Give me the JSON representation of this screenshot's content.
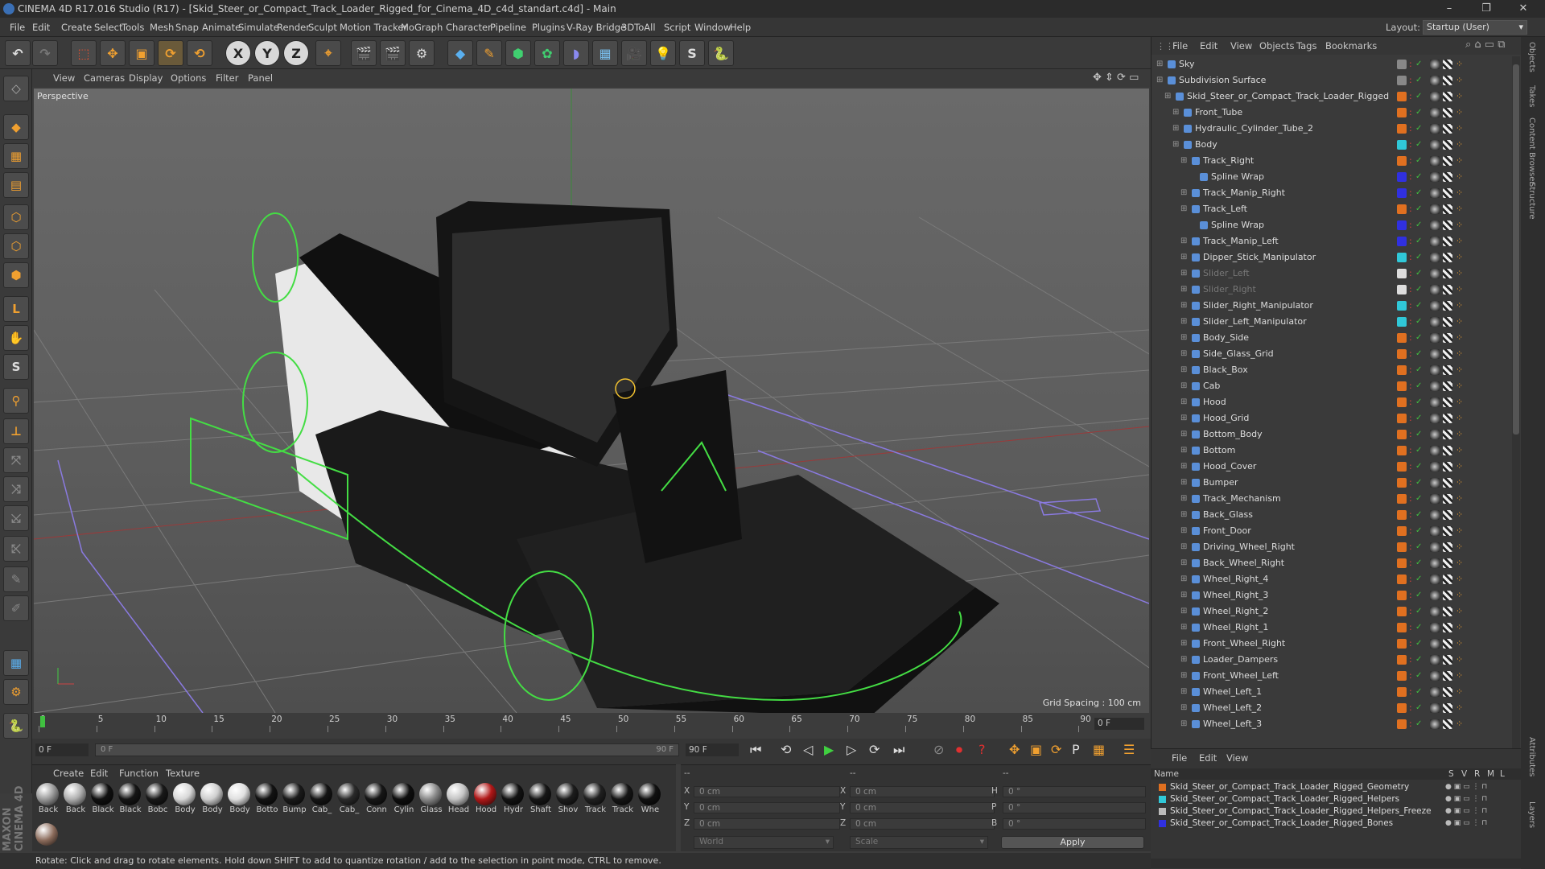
{
  "window": {
    "title": "CINEMA 4D R17.016 Studio (R17) - [Skid_Steer_or_Compact_Track_Loader_Rigged_for_Cinema_4D_c4d_standart.c4d] - Main",
    "minimize": "–",
    "restore": "❐",
    "close": "✕"
  },
  "menubar": {
    "items": [
      "File",
      "Edit",
      "Create",
      "Select",
      "Tools",
      "Mesh",
      "Snap",
      "Animate",
      "Simulate",
      "Render",
      "Sculpt",
      "Motion Tracker",
      "MoGraph",
      "Character",
      "Pipeline",
      "Plugins",
      "V-Ray Bridge",
      "3DToAll",
      "Script",
      "Window",
      "Help"
    ],
    "layout_label": "Layout:",
    "layout_value": "Startup (User)"
  },
  "toolbar": {
    "axis_x": "X",
    "axis_y": "Y",
    "axis_z": "Z"
  },
  "viewport": {
    "menu": [
      "View",
      "Cameras",
      "Display",
      "Options",
      "Filter",
      "Panel"
    ],
    "label": "Perspective",
    "grid_spacing": "Grid Spacing : 100 cm"
  },
  "timeline": {
    "ticks": [
      "0",
      "5",
      "10",
      "15",
      "20",
      "25",
      "30",
      "35",
      "40",
      "45",
      "50",
      "55",
      "60",
      "65",
      "70",
      "75",
      "80",
      "85",
      "90"
    ],
    "current_frame": "0 F",
    "start_field": "0 F",
    "range_start": "0 F",
    "range_end": "90 F",
    "end_field": "90 F"
  },
  "materials": {
    "menu": [
      "Create",
      "Edit",
      "Function",
      "Texture"
    ],
    "items": [
      {
        "name": "Back",
        "color": "#9a9a9a"
      },
      {
        "name": "Back",
        "color": "#b0b0b0"
      },
      {
        "name": "Black",
        "color": "#101010"
      },
      {
        "name": "Black",
        "color": "#151515"
      },
      {
        "name": "Bobc",
        "color": "#181818"
      },
      {
        "name": "Body",
        "color": "#d8d8d8"
      },
      {
        "name": "Body",
        "color": "#cfcfcf"
      },
      {
        "name": "Body",
        "color": "#e0e0e0"
      },
      {
        "name": "Botto",
        "color": "#121212"
      },
      {
        "name": "Bump",
        "color": "#1a1a1a"
      },
      {
        "name": "Cab_",
        "color": "#141414"
      },
      {
        "name": "Cab_",
        "color": "#2a2a2a"
      },
      {
        "name": "Conn",
        "color": "#161616"
      },
      {
        "name": "Cylin",
        "color": "#0e0e0e"
      },
      {
        "name": "Glass",
        "color": "#8a8a8a"
      },
      {
        "name": "Head",
        "color": "#c4c4c4"
      },
      {
        "name": "Hood",
        "color": "#b01818"
      },
      {
        "name": "Hydr",
        "color": "#121212"
      },
      {
        "name": "Shaft",
        "color": "#161616"
      },
      {
        "name": "Shov",
        "color": "#1c1c1c"
      },
      {
        "name": "Track",
        "color": "#202020"
      },
      {
        "name": "Track",
        "color": "#151515"
      },
      {
        "name": "Whe",
        "color": "#101010"
      }
    ],
    "extra_color": "#8a6a5a"
  },
  "attributes": {
    "x_label": "X",
    "y_label": "Y",
    "z_label": "Z",
    "pos_x": "0 cm",
    "pos_y": "0 cm",
    "pos_z": "0 cm",
    "size_x_label": "X",
    "size_y_label": "Y",
    "size_z_label": "Z",
    "size_x": "0 cm",
    "size_y": "0 cm",
    "size_z": "0 cm",
    "h_label": "H",
    "p_label": "P",
    "b_label": "B",
    "h": "0 °",
    "p": "0 °",
    "b": "0 °",
    "coord_mode": "World",
    "size_mode": "Scale",
    "apply": "Apply",
    "header_left": "--",
    "header_mid": "--",
    "header_right": "--"
  },
  "status": "Rotate: Click and drag to rotate elements. Hold down SHIFT to add to quantize rotation / add to the selection in point mode, CTRL to remove.",
  "object_manager": {
    "menu": [
      "File",
      "Edit",
      "View",
      "Objects",
      "Tags",
      "Bookmarks"
    ],
    "objects": [
      {
        "name": "Sky",
        "indent": 0,
        "color": "#888888"
      },
      {
        "name": "Subdivision Surface",
        "indent": 0,
        "color": "#888888"
      },
      {
        "name": "Skid_Steer_or_Compact_Track_Loader_Rigged",
        "indent": 1,
        "color": "#e07020"
      },
      {
        "name": "Front_Tube",
        "indent": 2,
        "color": "#e07020"
      },
      {
        "name": "Hydraulic_Cylinder_Tube_2",
        "indent": 2,
        "color": "#e07020"
      },
      {
        "name": "Body",
        "indent": 2,
        "color": "#30c8d8"
      },
      {
        "name": "Track_Right",
        "indent": 3,
        "color": "#e07020"
      },
      {
        "name": "Spline Wrap",
        "indent": 4,
        "color": "#3030e0"
      },
      {
        "name": "Track_Manip_Right",
        "indent": 3,
        "color": "#3030e0"
      },
      {
        "name": "Track_Left",
        "indent": 3,
        "color": "#e07020"
      },
      {
        "name": "Spline Wrap",
        "indent": 4,
        "color": "#3030e0"
      },
      {
        "name": "Track_Manip_Left",
        "indent": 3,
        "color": "#3030e0"
      },
      {
        "name": "Dipper_Stick_Manipulator",
        "indent": 3,
        "color": "#30c8d8"
      },
      {
        "name": "Slider_Left",
        "indent": 3,
        "color": "#dddddd",
        "dim": true
      },
      {
        "name": "Slider_Right",
        "indent": 3,
        "color": "#dddddd",
        "dim": true
      },
      {
        "name": "Slider_Right_Manipulator",
        "indent": 3,
        "color": "#30c8d8"
      },
      {
        "name": "Slider_Left_Manipulator",
        "indent": 3,
        "color": "#30c8d8"
      },
      {
        "name": "Body_Side",
        "indent": 3,
        "color": "#e07020"
      },
      {
        "name": "Side_Glass_Grid",
        "indent": 3,
        "color": "#e07020"
      },
      {
        "name": "Black_Box",
        "indent": 3,
        "color": "#e07020"
      },
      {
        "name": "Cab",
        "indent": 3,
        "color": "#e07020"
      },
      {
        "name": "Hood",
        "indent": 3,
        "color": "#e07020"
      },
      {
        "name": "Hood_Grid",
        "indent": 3,
        "color": "#e07020"
      },
      {
        "name": "Bottom_Body",
        "indent": 3,
        "color": "#e07020"
      },
      {
        "name": "Bottom",
        "indent": 3,
        "color": "#e07020"
      },
      {
        "name": "Hood_Cover",
        "indent": 3,
        "color": "#e07020"
      },
      {
        "name": "Bumper",
        "indent": 3,
        "color": "#e07020"
      },
      {
        "name": "Track_Mechanism",
        "indent": 3,
        "color": "#e07020"
      },
      {
        "name": "Back_Glass",
        "indent": 3,
        "color": "#e07020"
      },
      {
        "name": "Front_Door",
        "indent": 3,
        "color": "#e07020"
      },
      {
        "name": "Driving_Wheel_Right",
        "indent": 3,
        "color": "#e07020"
      },
      {
        "name": "Back_Wheel_Right",
        "indent": 3,
        "color": "#e07020"
      },
      {
        "name": "Wheel_Right_4",
        "indent": 3,
        "color": "#e07020"
      },
      {
        "name": "Wheel_Right_3",
        "indent": 3,
        "color": "#e07020"
      },
      {
        "name": "Wheel_Right_2",
        "indent": 3,
        "color": "#e07020"
      },
      {
        "name": "Wheel_Right_1",
        "indent": 3,
        "color": "#e07020"
      },
      {
        "name": "Front_Wheel_Right",
        "indent": 3,
        "color": "#e07020"
      },
      {
        "name": "Loader_Dampers",
        "indent": 3,
        "color": "#e07020"
      },
      {
        "name": "Front_Wheel_Left",
        "indent": 3,
        "color": "#e07020"
      },
      {
        "name": "Wheel_Left_1",
        "indent": 3,
        "color": "#e07020"
      },
      {
        "name": "Wheel_Left_2",
        "indent": 3,
        "color": "#e07020"
      },
      {
        "name": "Wheel_Left_3",
        "indent": 3,
        "color": "#e07020"
      }
    ]
  },
  "layer_manager": {
    "menu": [
      "File",
      "Edit",
      "View"
    ],
    "columns": [
      "Name",
      "S",
      "V",
      "R",
      "M",
      "L"
    ],
    "layers": [
      {
        "name": "Skid_Steer_or_Compact_Track_Loader_Rigged_Geometry",
        "color": "#e07020"
      },
      {
        "name": "Skid_Steer_or_Compact_Track_Loader_Rigged_Helpers",
        "color": "#30c8d8"
      },
      {
        "name": "Skid_Steer_or_Compact_Track_Loader_Rigged_Helpers_Freeze",
        "color": "#bbbbbb"
      },
      {
        "name": "Skid_Steer_or_Compact_Track_Loader_Rigged_Bones",
        "color": "#3030e0"
      }
    ]
  },
  "right_tabs": [
    "Objects",
    "Takes",
    "Content Browser",
    "Structure",
    "Attributes",
    "Layers"
  ],
  "colors": {
    "accent": "#f0a030",
    "rig_green": "#44dd44",
    "spline_purple": "#8a7ae0"
  }
}
